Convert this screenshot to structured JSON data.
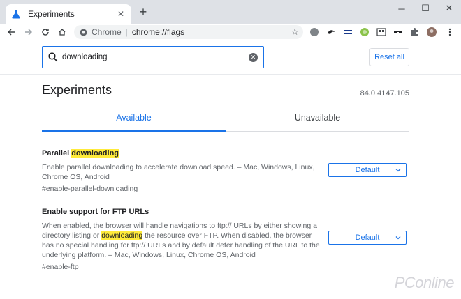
{
  "tab": {
    "title": "Experiments"
  },
  "toolbar": {
    "site_label": "Chrome",
    "url": "chrome://flags"
  },
  "search": {
    "value": "downloading",
    "placeholder": "Search flags"
  },
  "header": {
    "reset_label": "Reset all"
  },
  "page": {
    "title": "Experiments",
    "version": "84.0.4147.105"
  },
  "tabs": [
    {
      "label": "Available"
    },
    {
      "label": "Unavailable"
    }
  ],
  "flags": [
    {
      "name_prefix": "Parallel ",
      "name_highlight": "downloading",
      "desc": "Enable parallel downloading to accelerate download speed. – Mac, Windows, Linux, Chrome OS, Android",
      "link": "#enable-parallel-downloading",
      "select_value": "Default"
    },
    {
      "name": "Enable support for FTP URLs",
      "desc_part1": "When enabled, the browser will handle navigations to ftp:// URLs by either showing a directory listing or ",
      "desc_highlight": "downloading",
      "desc_part2": " the resource over FTP. When disabled, the browser has no special handling for ftp:// URLs and by default defer handling of the URL to the underlying platform. – Mac, Windows, Linux, Chrome OS, Android",
      "link": "#enable-ftp",
      "select_value": "Default"
    }
  ],
  "watermark": "PConline",
  "colors": {
    "accent": "#1a73e8",
    "highlight": "#ffeb3b"
  }
}
